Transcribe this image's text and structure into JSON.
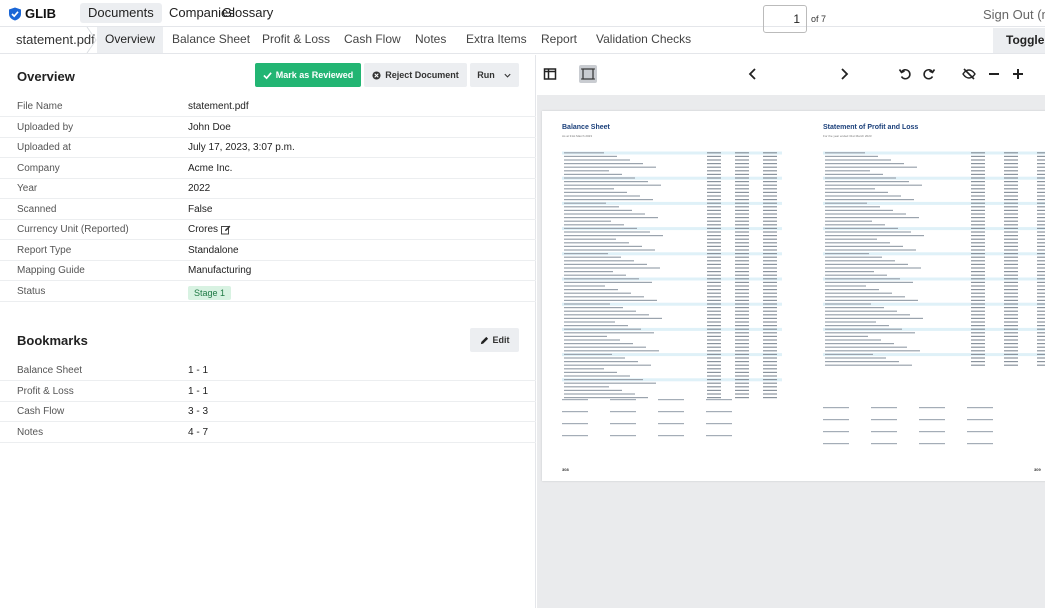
{
  "app": {
    "logo_text": "GLIB"
  },
  "topnav": {
    "items": [
      "Documents",
      "Companies",
      "Glossary"
    ],
    "signout_label": "Sign Out (moh"
  },
  "tabs": {
    "file_name": "statement.pdf",
    "items": [
      "Overview",
      "Balance Sheet",
      "Profit & Loss",
      "Cash Flow",
      "Notes",
      "Extra Items",
      "Report",
      "Validation Checks"
    ],
    "toggle_label": "Toggle P"
  },
  "overview": {
    "title": "Overview",
    "mark_reviewed_label": "Mark as Reviewed",
    "reject_label": "Reject Document",
    "run_label": "Run",
    "rows": [
      {
        "label": "File Name",
        "value": "statement.pdf"
      },
      {
        "label": "Uploaded by",
        "value": "John Doe"
      },
      {
        "label": "Uploaded at",
        "value": "July 17, 2023, 3:07 p.m."
      },
      {
        "label": "Company",
        "value": "Acme Inc."
      },
      {
        "label": "Year",
        "value": "2022"
      },
      {
        "label": "Scanned",
        "value": "False"
      },
      {
        "label": "Currency Unit (Reported)",
        "value": "Crores"
      },
      {
        "label": "Report Type",
        "value": "Standalone"
      },
      {
        "label": "Mapping Guide",
        "value": "Manufacturing"
      },
      {
        "label": "Status",
        "value": "Stage 1"
      }
    ]
  },
  "bookmarks": {
    "title": "Bookmarks",
    "edit_label": "Edit",
    "rows": [
      {
        "label": "Balance Sheet",
        "value": "1 - 1"
      },
      {
        "label": "Profit & Loss",
        "value": "1 - 1"
      },
      {
        "label": "Cash Flow",
        "value": "3 - 3"
      },
      {
        "label": "Notes",
        "value": "4 - 7"
      }
    ]
  },
  "viewer": {
    "page_current": "1",
    "page_of": "of 7",
    "page_left_title": "Balance Sheet",
    "page_left_sub": "As at 31st March 2023",
    "page_right_title": "Statement of Profit and Loss",
    "page_right_sub": "For the year ended 31st March 2023",
    "page_left_number": "308",
    "page_right_number": "309"
  },
  "colors": {
    "accent_green": "#22b573",
    "badge_green_bg": "#d8f2e2",
    "pdf_blue": "#1a3f7a"
  }
}
